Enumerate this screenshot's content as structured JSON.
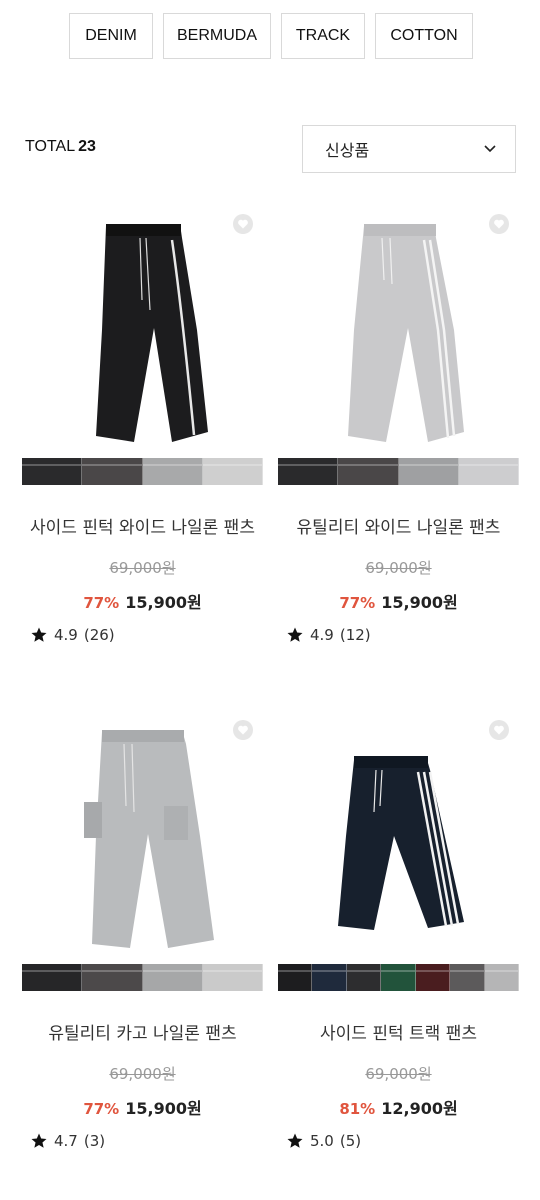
{
  "filters": [
    "DENIM",
    "BERMUDA",
    "TRACK",
    "COTTON"
  ],
  "total": {
    "label": "TOTAL",
    "count": "23"
  },
  "sort": {
    "selected": "신상품"
  },
  "products": [
    {
      "name": "사이드 핀턱 와이드 나일론 팬츠",
      "original_price": "69,000원",
      "discount": "77%",
      "price": "15,900원",
      "rating": "4.9",
      "reviews": "(26)",
      "pants_color": "#1c1c1e",
      "stripe_color": "#e8e8e8",
      "swatches": [
        "#2a2a2c",
        "#4a4748",
        "#a8a9aa",
        "#cfcfcf"
      ]
    },
    {
      "name": "유틸리티 와이드 나일론 팬츠",
      "original_price": "69,000원",
      "discount": "77%",
      "price": "15,900원",
      "rating": "4.9",
      "reviews": "(12)",
      "pants_color": "#c9c9cb",
      "stripe_color": "#f4f4f4",
      "swatches": [
        "#2a2a2c",
        "#4a4748",
        "#9fa0a2",
        "#cdcdcf"
      ]
    },
    {
      "name": "유틸리티 카고 나일론 팬츠",
      "original_price": "69,000원",
      "discount": "77%",
      "price": "15,900원",
      "rating": "4.7",
      "reviews": "(3)",
      "pants_color": "#b9bbbd",
      "stripe_color": "#b9bbbd",
      "swatches": [
        "#262628",
        "#4c494a",
        "#a6a7a8",
        "#cacaca"
      ]
    },
    {
      "name": "사이드 핀턱 트랙 팬츠",
      "original_price": "69,000원",
      "discount": "81%",
      "price": "12,900원",
      "rating": "5.0",
      "reviews": "(5)",
      "pants_color": "#17202d",
      "stripe_color": "#f2f2f2",
      "swatches": [
        "#1d1d1f",
        "#1f2a3c",
        "#2d2d2f",
        "#22533b",
        "#4a1d1f",
        "#5c5a5b",
        "#b5b5b6"
      ]
    }
  ]
}
